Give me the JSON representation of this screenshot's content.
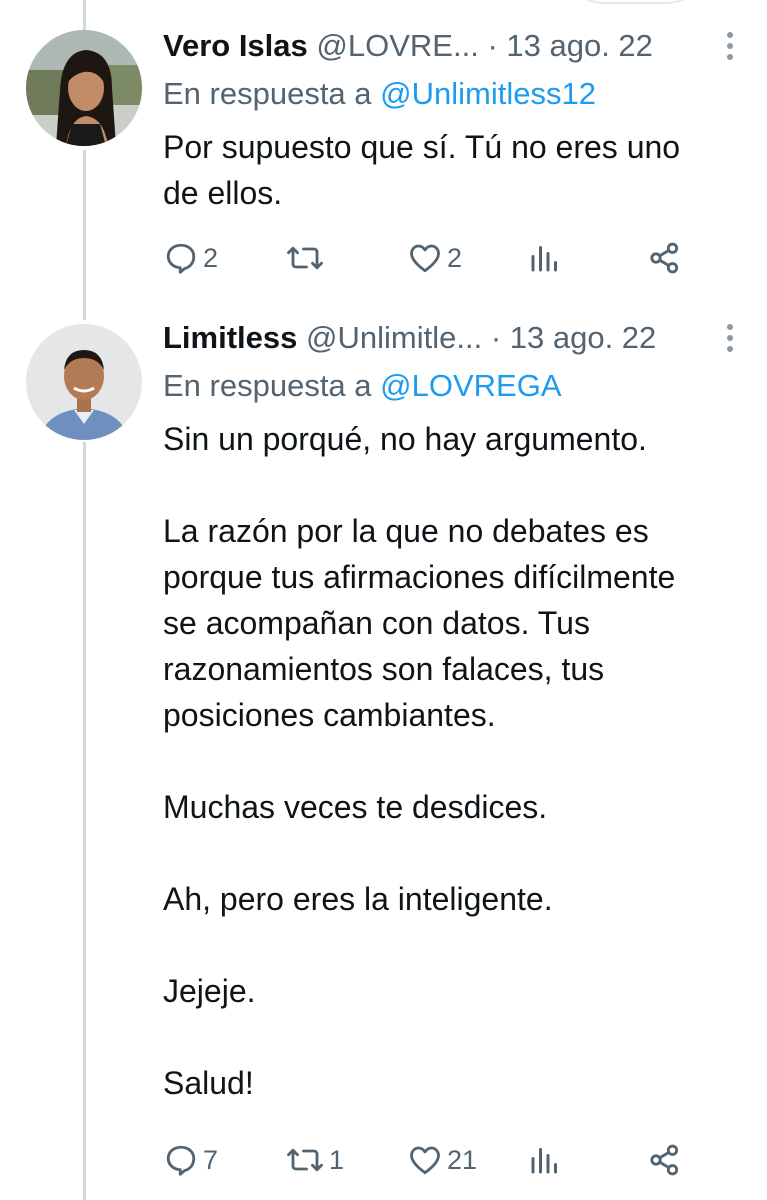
{
  "tweets": [
    {
      "author": {
        "name": "Vero Islas",
        "handle": "@LOVRE...",
        "avatar": "woman-avatar-photo"
      },
      "separator": "·",
      "date": "13 ago. 22",
      "reply_prefix": "En respuesta a",
      "reply_to": "@Unlimitless12",
      "body_lines": [
        "Por supuesto que sí. Tú no eres uno",
        "de ellos."
      ],
      "stats": {
        "replies": "2",
        "retweets": "",
        "likes": "2"
      }
    },
    {
      "author": {
        "name": "Limitless",
        "handle": "@Unlimitle...",
        "avatar": "man-avatar-photo"
      },
      "separator": "·",
      "date": "13 ago. 22",
      "reply_prefix": "En respuesta a",
      "reply_to": "@LOVREGA",
      "body_paragraphs": [
        "Sin un porqué, no hay argumento.",
        "La razón por la que no debates es\nporque tus afirmaciones difícilmente\nse acompañan con datos. Tus\nrazonamientos son falaces, tus\nposiciones cambiantes.",
        "Muchas veces te desdices.",
        "Ah, pero eres la inteligente.",
        "Jejeje.",
        "Salud!"
      ],
      "stats": {
        "replies": "7",
        "retweets": "1",
        "likes": "21"
      }
    }
  ],
  "icons": {
    "reply": "speech-bubble-icon",
    "retweet": "retweet-arrows-icon",
    "like": "heart-icon",
    "views": "bar-chart-icon",
    "share": "share-nodes-icon",
    "more": "vertical-ellipsis-icon"
  },
  "colors": {
    "text": "#0f1419",
    "secondary": "#536471",
    "link": "#1d9bf0",
    "thread_line": "#cfd9de"
  }
}
